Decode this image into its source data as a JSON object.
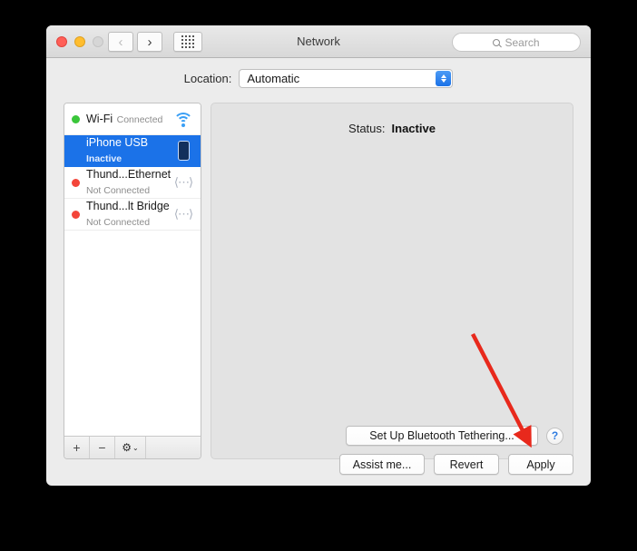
{
  "window": {
    "title": "Network",
    "traffic_lights": [
      "close",
      "minimize",
      "zoom"
    ],
    "nav": {
      "back": "‹",
      "forward": "›",
      "grid": "grid-icon"
    },
    "search": {
      "placeholder": "Search",
      "value": ""
    }
  },
  "location": {
    "label": "Location:",
    "value": "Automatic",
    "options": [
      "Automatic"
    ]
  },
  "sidebar": {
    "items": [
      {
        "name": "Wi-Fi",
        "status": "Connected",
        "dot": "green",
        "icon": "wifi-icon",
        "selected": false
      },
      {
        "name": "iPhone USB",
        "status": "Inactive",
        "dot": "none",
        "icon": "iphone-icon",
        "selected": true
      },
      {
        "name": "Thund...Ethernet",
        "status": "Not Connected",
        "dot": "red",
        "icon": "thunderbolt-icon",
        "selected": false
      },
      {
        "name": "Thund...lt Bridge",
        "status": "Not Connected",
        "dot": "red",
        "icon": "thunderbolt-icon",
        "selected": false
      }
    ],
    "toolbar": {
      "add": "+",
      "remove": "−",
      "gear": "⚙",
      "gear_chevron": "⌄"
    }
  },
  "detail": {
    "status_label": "Status:",
    "status_value": "Inactive",
    "tether_button": "Set Up Bluetooth Tethering...",
    "help_button": "?"
  },
  "bottom": {
    "assist": "Assist me...",
    "revert": "Revert",
    "apply": "Apply"
  },
  "annotation": {
    "arrow_color": "#e8291c",
    "points_to": "Apply"
  },
  "colors": {
    "selection_blue": "#1b72e8",
    "status_green": "#3ac63a",
    "status_red": "#f3453a",
    "accent_blue": "#2f7ce0",
    "window_bg": "#ececec",
    "panel_bg": "#e3e3e3"
  }
}
